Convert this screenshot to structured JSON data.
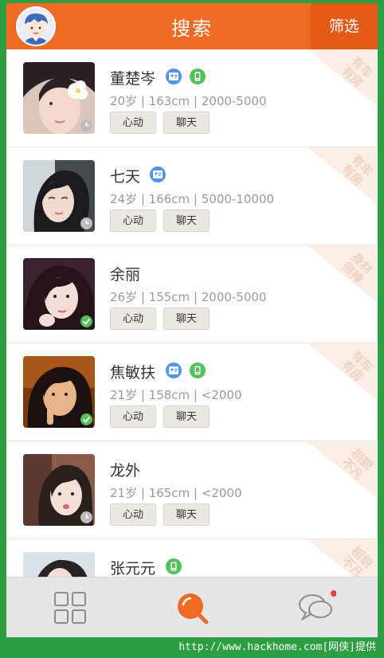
{
  "header": {
    "title": "搜索",
    "filter_label": "筛选"
  },
  "colors": {
    "accent": "#ee6a25",
    "tag_bg": "#fbeee5",
    "badge_blue": "#4f95e8",
    "badge_green": "#52c15c"
  },
  "list": [
    {
      "name": "董楚岑",
      "info": "20岁 | 163cm | 2000-5000",
      "like": "心动",
      "chat": "聊天",
      "tag": "有车有房",
      "badges": [
        "id-badge-icon",
        "phone-badge-icon"
      ],
      "status": "clock"
    },
    {
      "name": "七天",
      "info": "24岁 | 166cm | 5000-10000",
      "like": "心动",
      "chat": "聊天",
      "tag": "有车有房",
      "badges": [
        "id-badge-icon"
      ],
      "status": "clock"
    },
    {
      "name": "余丽",
      "info": "26岁 | 155cm | 2000-5000",
      "like": "心动",
      "chat": "聊天",
      "tag": "身材很棒",
      "badges": [],
      "status": "check"
    },
    {
      "name": "焦敏扶",
      "info": "21岁 | 158cm | <2000",
      "like": "心动",
      "chat": "聊天",
      "tag": "有车有房",
      "badges": [
        "id-badge-icon",
        "phone-badge-icon"
      ],
      "status": "check"
    },
    {
      "name": "龙外",
      "info": "21岁 | 165cm | <2000",
      "like": "心动",
      "chat": "聊天",
      "tag": "相貌不凡",
      "badges": [],
      "status": "clock"
    },
    {
      "name": "张元元",
      "info": "",
      "like": "",
      "chat": "",
      "tag": "相貌不凡",
      "badges": [
        "phone-badge-icon"
      ],
      "status": ""
    }
  ],
  "tabs": [
    {
      "name": "grid-tab-icon"
    },
    {
      "name": "search-tab-icon",
      "active": true
    },
    {
      "name": "chat-tab-icon",
      "notification": true
    }
  ],
  "watermark": "http://www.hackhome.com[网侠]提供"
}
